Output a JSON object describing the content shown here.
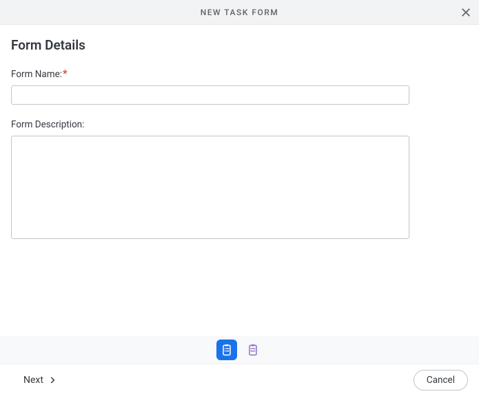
{
  "header": {
    "title": "NEW TASK FORM"
  },
  "form": {
    "section_title": "Form Details",
    "name_label": "Form Name:",
    "name_value": "",
    "description_label": "Form Description:",
    "description_value": ""
  },
  "footer": {
    "next_label": "Next",
    "cancel_label": "Cancel"
  }
}
